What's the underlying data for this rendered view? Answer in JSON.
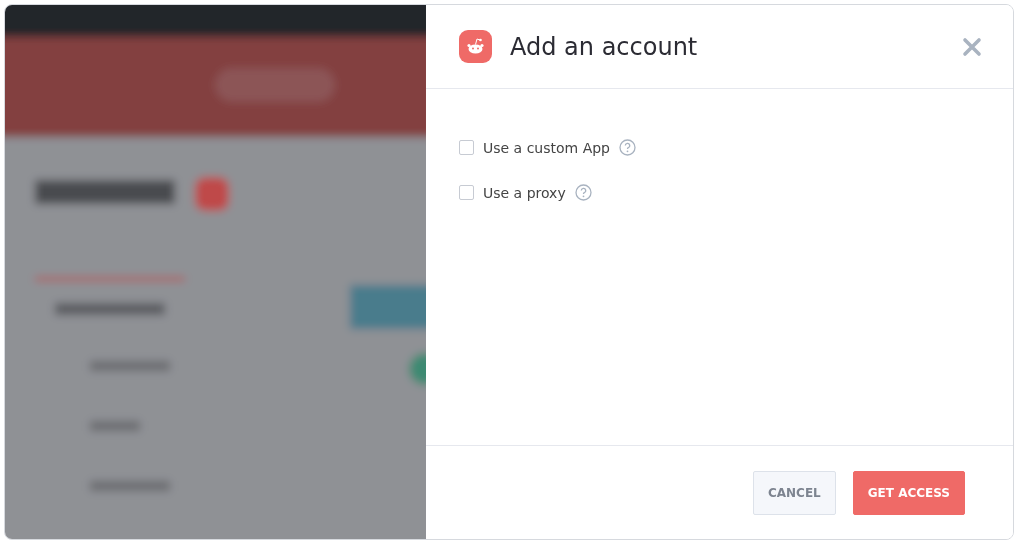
{
  "dialog": {
    "title": "Add an account",
    "options": [
      {
        "label": "Use a custom App",
        "checked": false
      },
      {
        "label": "Use a proxy",
        "checked": false
      }
    ],
    "buttons": [
      {
        "label": "CANCEL",
        "kind": "secondary"
      },
      {
        "label": "GET ACCESS",
        "kind": "primary"
      }
    ]
  }
}
